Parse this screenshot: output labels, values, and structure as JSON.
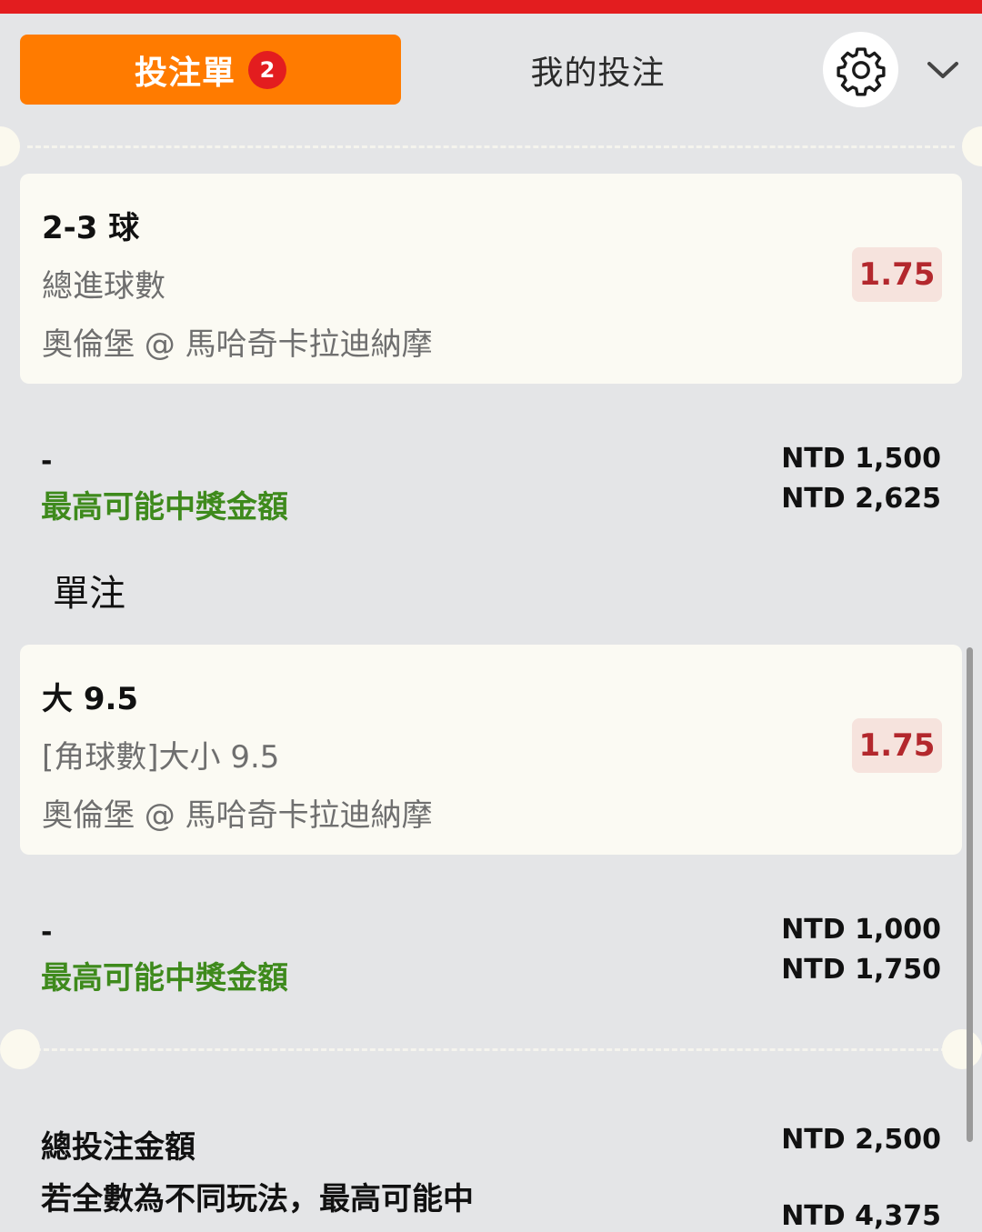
{
  "tabs": {
    "betslip_label": "投注單",
    "betslip_count": "2",
    "my_bets_label": "我的投注"
  },
  "icons": {
    "settings": "gear-icon",
    "collapse": "chevron-down-icon"
  },
  "bets": [
    {
      "selection": "2-3 球",
      "market": "總進球數",
      "event": "奧倫堡 @ 馬哈奇卡拉迪納摩",
      "odds": "1.75",
      "stake_placeholder": "-",
      "stake": "NTD 1,500",
      "max_win_label": "最高可能中獎金額",
      "max_win": "NTD 2,625"
    },
    {
      "selection": "大 9.5",
      "market": "[角球數]大小 9.5",
      "event": "奧倫堡 @ 馬哈奇卡拉迪納摩",
      "odds": "1.75",
      "stake_placeholder": "-",
      "stake": "NTD 1,000",
      "max_win_label": "最高可能中獎金額",
      "max_win": "NTD 1,750"
    }
  ],
  "single_label": "單注",
  "summary": {
    "total_stake_label": "總投注金額",
    "total_stake": "NTD 2,500",
    "max_win_label": "若全數為不同玩法，最高可能中",
    "max_win": "NTD 4,375"
  },
  "colors": {
    "top_bar": "#e31d1f",
    "active_tab": "#ff7b00",
    "badge": "#e31d1f",
    "odds_text": "#b3282d",
    "odds_bg": "#f6e3dd",
    "max_win_text": "#3e8a1c",
    "background": "#e4e5e7",
    "card": "#fbfaf3"
  }
}
